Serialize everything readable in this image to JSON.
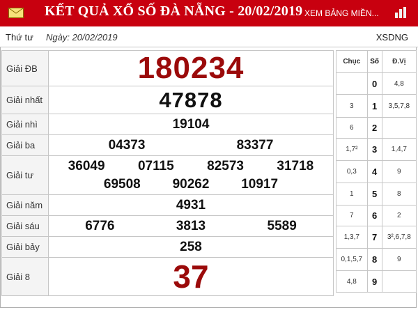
{
  "header": {
    "title": "KẾT QUẢ XỔ SỐ ĐÀ NẴNG - 20/02/2019",
    "link_label": "XEM BẢNG MIỀN...",
    "bg_color": "#c8000f"
  },
  "subheader": {
    "day_of_week": "Thứ tư",
    "date_label": "Ngày: 20/02/2019",
    "code": "XSDNG"
  },
  "prizes": [
    {
      "label": "Giải ĐB",
      "numbers": [
        "180234"
      ]
    },
    {
      "label": "Giải nhất",
      "numbers": [
        "47878"
      ]
    },
    {
      "label": "Giải nhì",
      "numbers": [
        "19104"
      ]
    },
    {
      "label": "Giải ba",
      "numbers": [
        "04373",
        "83377"
      ]
    },
    {
      "label": "Giải tư",
      "numbers": [
        "36049",
        "07115",
        "82573",
        "31718",
        "69508",
        "90262",
        "10917"
      ]
    },
    {
      "label": "Giải năm",
      "numbers": [
        "4931"
      ]
    },
    {
      "label": "Giải sáu",
      "numbers": [
        "6776",
        "3813",
        "5589"
      ]
    },
    {
      "label": "Giải bảy",
      "numbers": [
        "258"
      ]
    },
    {
      "label": "Giải 8",
      "numbers": [
        "37"
      ]
    }
  ],
  "loto_table": {
    "headers": {
      "chuc": "Chục",
      "so": "Số",
      "dv": "Đ.Vị"
    },
    "rows": [
      {
        "chuc": "",
        "so": "0",
        "dv": "4,8"
      },
      {
        "chuc": "3",
        "so": "1",
        "dv": "3,5,7,8"
      },
      {
        "chuc": "6",
        "so": "2",
        "dv": ""
      },
      {
        "chuc": "1,7²",
        "so": "3",
        "dv": "1,4,7"
      },
      {
        "chuc": "0,3",
        "so": "4",
        "dv": "9"
      },
      {
        "chuc": "1",
        "so": "5",
        "dv": "8"
      },
      {
        "chuc": "7",
        "so": "6",
        "dv": "2"
      },
      {
        "chuc": "1,3,7",
        "so": "7",
        "dv": "3²,6,7,8"
      },
      {
        "chuc": "0,1,5,7",
        "so": "8",
        "dv": "9"
      },
      {
        "chuc": "4,8",
        "so": "9",
        "dv": ""
      }
    ]
  },
  "colors": {
    "special_prize": "#9b0a0a",
    "border": "#c6c6c6"
  }
}
